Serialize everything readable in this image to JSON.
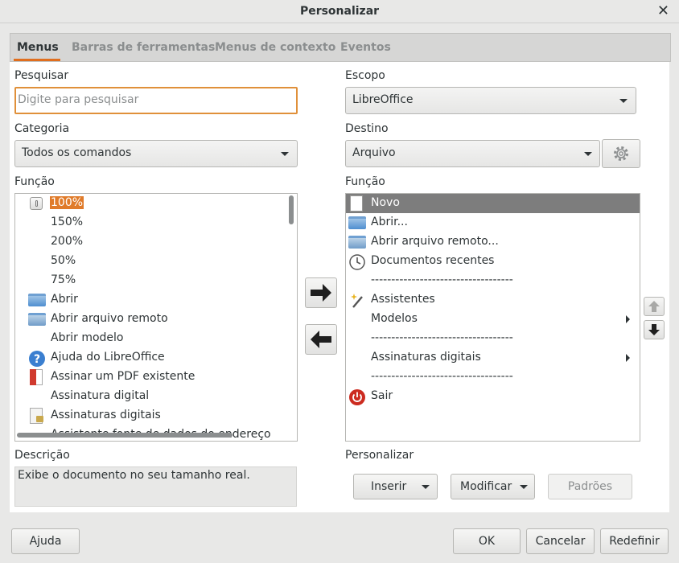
{
  "window": {
    "title": "Personalizar",
    "close_glyph": "✕"
  },
  "tabs": [
    {
      "label": "Menus",
      "active": true
    },
    {
      "label": "Barras de ferramentas",
      "active": false
    },
    {
      "label": "Menus de contexto",
      "active": false
    },
    {
      "label": "Eventos",
      "active": false
    }
  ],
  "left": {
    "search_label": "Pesquisar",
    "search_placeholder": "Digite para pesquisar",
    "search_value": "",
    "category_label": "Categoria",
    "category_value": "Todos os comandos",
    "function_label": "Função",
    "functions": [
      {
        "label": "100%",
        "icon": "zoom-icon",
        "selected": true
      },
      {
        "label": "150%",
        "icon": "none"
      },
      {
        "label": "200%",
        "icon": "none"
      },
      {
        "label": "50%",
        "icon": "none"
      },
      {
        "label": "75%",
        "icon": "none"
      },
      {
        "label": "Abrir",
        "icon": "folder-icon"
      },
      {
        "label": "Abrir arquivo remoto",
        "icon": "remote-folder-icon"
      },
      {
        "label": "Abrir modelo",
        "icon": "none"
      },
      {
        "label": "Ajuda do LibreOffice",
        "icon": "help-icon"
      },
      {
        "label": "Assinar um PDF existente",
        "icon": "sign-pdf-icon"
      },
      {
        "label": "Assinatura digital",
        "icon": "none"
      },
      {
        "label": "Assinaturas digitais",
        "icon": "lock-icon"
      },
      {
        "label": "Assistente fonte de dados do endereço",
        "icon": "none"
      }
    ],
    "description_label": "Descrição",
    "description_text": "Exibe o documento no seu tamanho real."
  },
  "right": {
    "scope_label": "Escopo",
    "scope_value": "LibreOffice",
    "target_label": "Destino",
    "target_value": "Arquivo",
    "function_label": "Função",
    "entries": [
      {
        "label": "Novo",
        "icon": "new-document-icon",
        "selected": true,
        "submenu": false
      },
      {
        "label": "Abrir...",
        "icon": "folder-icon",
        "submenu": false
      },
      {
        "label": "Abrir arquivo remoto...",
        "icon": "remote-folder-icon",
        "submenu": false
      },
      {
        "label": "Documentos recentes",
        "icon": "recent-documents-icon",
        "submenu": false
      },
      {
        "label": "-----------------------------------",
        "icon": "none",
        "submenu": false
      },
      {
        "label": "Assistentes",
        "icon": "wizard-icon",
        "submenu": false
      },
      {
        "label": "Modelos",
        "icon": "none",
        "submenu": true
      },
      {
        "label": "-----------------------------------",
        "icon": "none",
        "submenu": false
      },
      {
        "label": "Assinaturas digitais",
        "icon": "none",
        "submenu": true
      },
      {
        "label": "-----------------------------------",
        "icon": "none",
        "submenu": false
      },
      {
        "label": "Sair",
        "icon": "power-icon",
        "submenu": false
      }
    ],
    "customize_label": "Personalizar",
    "insert_label": "Inserir",
    "modify_label": "Modificar",
    "defaults_label": "Padrões"
  },
  "footer": {
    "help_label": "Ajuda",
    "ok_label": "OK",
    "cancel_label": "Cancelar",
    "reset_label": "Redefinir"
  },
  "colors": {
    "accent": "#e06e1e",
    "selection_right": "#7d7d7d",
    "selection_left": "#e07b2a"
  }
}
